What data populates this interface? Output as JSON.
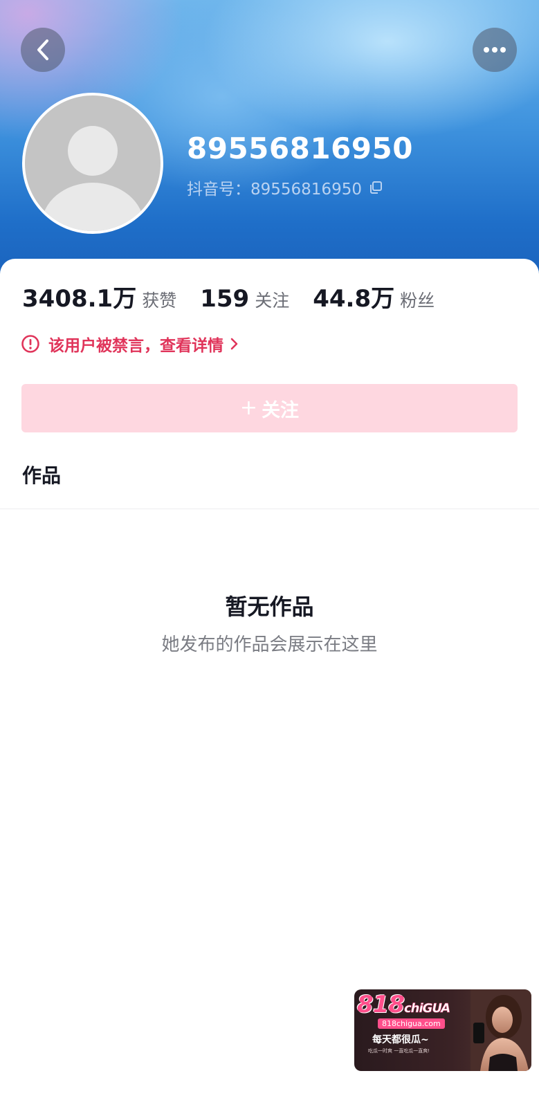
{
  "header": {
    "username": "89556816950",
    "douyin_id_label": "抖音号：89556816950"
  },
  "stats": [
    {
      "value": "3408.1万",
      "label": "获赞"
    },
    {
      "value": "159",
      "label": "关注"
    },
    {
      "value": "44.8万",
      "label": "粉丝"
    }
  ],
  "ban_notice": {
    "text": "该用户被禁言，查看详情"
  },
  "follow_button": {
    "plus": "+",
    "label": "关注"
  },
  "tabs": [
    {
      "label": "作品"
    }
  ],
  "empty_state": {
    "title": "暂无作品",
    "subtitle": "她发布的作品会展示在这里"
  },
  "watermark": {
    "logo_main": "818",
    "logo_small": "chiGUA",
    "site": "818chigua.com",
    "slogan": "每天都很瓜~",
    "tagline": "吃瓜一时爽 一直吃瓜一直爽!"
  },
  "colors": {
    "accent": "#e0345a",
    "follow_bg": "#fed7e0",
    "text_primary": "#161823",
    "text_secondary": "#6b6d75"
  },
  "icons": [
    "back-arrow-icon",
    "more-dots-icon",
    "avatar-placeholder-icon",
    "copy-icon",
    "warning-circle-icon",
    "chevron-right-icon"
  ]
}
